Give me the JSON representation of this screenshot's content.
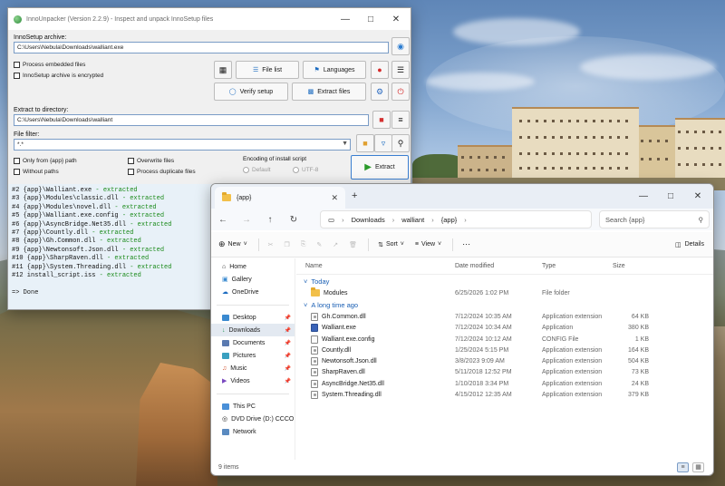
{
  "inno": {
    "title": "InnoUnpacker (Version 2.2.9) - Inspect and unpack InnoSetup files",
    "archive_label": "InnoSetup archive:",
    "archive_value": "C:\\Users\\Nebula\\Downloads\\walliant.exe",
    "process_embedded": "Process embedded files",
    "encrypted": "InnoSetup archive is encrypted",
    "file_list": "File list",
    "languages": "Languages",
    "verify_setup": "Verify setup",
    "extract_files": "Extract files",
    "extract_dir_label": "Extract to directory:",
    "extract_dir_value": "C:\\Users\\Nebula\\Downloads\\walliant",
    "file_filter_label": "File filter:",
    "file_filter_value": "*.*",
    "only_from_app": "Only from {app} path",
    "overwrite": "Overwrite files",
    "without_paths": "Without paths",
    "process_duplicates": "Process duplicate files",
    "encoding_label": "Encoding of install script",
    "default": "Default",
    "utf8": "UTF-8",
    "extract": "Extract",
    "log": [
      {
        "prefix": "#2 {app}\\Walliant.exe",
        "status": " - extracted"
      },
      {
        "prefix": "#3 {app}\\Modules\\classic.dll",
        "status": " - extracted"
      },
      {
        "prefix": "#4 {app}\\Modules\\novel.dll",
        "status": " - extracted"
      },
      {
        "prefix": "#5 {app}\\Walliant.exe.config",
        "status": " - extracted"
      },
      {
        "prefix": "#6 {app}\\AsyncBridge.Net35.dll",
        "status": " - extracted"
      },
      {
        "prefix": "#7 {app}\\Countly.dll",
        "status": " - extracted"
      },
      {
        "prefix": "#8 {app}\\Gh.Common.dll",
        "status": " - extracted"
      },
      {
        "prefix": "#9 {app}\\Newtonsoft.Json.dll",
        "status": " - extracted"
      },
      {
        "prefix": "#10 {app}\\SharpRaven.dll",
        "status": " - extracted"
      },
      {
        "prefix": "#11 {app}\\System.Threading.dll",
        "status": " - extracted"
      },
      {
        "prefix": "#12 install_script.iss",
        "status": " - extracted"
      }
    ],
    "done": "=> Done"
  },
  "explorer": {
    "tab_title": "{app}",
    "breadcrumb": [
      "Downloads",
      "walliant",
      "{app}"
    ],
    "search_placeholder": "Search {app}",
    "new": "New",
    "sort": "Sort",
    "view": "View",
    "details": "Details",
    "nav": {
      "home": "Home",
      "gallery": "Gallery",
      "onedrive": "OneDrive",
      "desktop": "Desktop",
      "downloads": "Downloads",
      "documents": "Documents",
      "pictures": "Pictures",
      "music": "Music",
      "videos": "Videos",
      "this_pc": "This PC",
      "dvd": "DVD Drive (D:) CCCO",
      "network": "Network"
    },
    "columns": {
      "name": "Name",
      "date": "Date modified",
      "type": "Type",
      "size": "Size"
    },
    "group_today": "Today",
    "group_long": "A long time ago",
    "today_rows": [
      {
        "name": "Modules",
        "date": "6/25/2026 1:02 PM",
        "type": "File folder",
        "size": "",
        "icon": "folder"
      }
    ],
    "old_rows": [
      {
        "name": "Gh.Common.dll",
        "date": "7/12/2024 10:35 AM",
        "type": "Application extension",
        "size": "64 KB",
        "icon": "dll"
      },
      {
        "name": "Walliant.exe",
        "date": "7/12/2024 10:34 AM",
        "type": "Application",
        "size": "380 KB",
        "icon": "exe"
      },
      {
        "name": "Walliant.exe.config",
        "date": "7/12/2024 10:12 AM",
        "type": "CONFIG File",
        "size": "1 KB",
        "icon": "file"
      },
      {
        "name": "Countly.dll",
        "date": "1/25/2024 5:15 PM",
        "type": "Application extension",
        "size": "164 KB",
        "icon": "dll"
      },
      {
        "name": "Newtonsoft.Json.dll",
        "date": "3/8/2023 9:09 AM",
        "type": "Application extension",
        "size": "504 KB",
        "icon": "dll"
      },
      {
        "name": "SharpRaven.dll",
        "date": "5/11/2018 12:52 PM",
        "type": "Application extension",
        "size": "73 KB",
        "icon": "dll"
      },
      {
        "name": "AsyncBridge.Net35.dll",
        "date": "1/10/2018 3:34 PM",
        "type": "Application extension",
        "size": "24 KB",
        "icon": "dll"
      },
      {
        "name": "System.Threading.dll",
        "date": "4/15/2012 12:35 AM",
        "type": "Application extension",
        "size": "379 KB",
        "icon": "dll"
      }
    ],
    "status": "9 items"
  }
}
